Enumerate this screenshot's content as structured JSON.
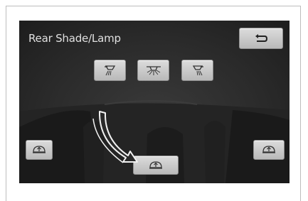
{
  "screen": {
    "title": "Rear Shade/Lamp"
  },
  "buttons": {
    "back": {
      "icon": "return-icon"
    },
    "lamp_left": {
      "icon": "lamp-left-icon"
    },
    "lamp_center": {
      "icon": "lamp-center-icon"
    },
    "lamp_right": {
      "icon": "lamp-right-icon"
    },
    "shade_left": {
      "icon": "shade-icon"
    },
    "shade_center": {
      "icon": "shade-icon"
    },
    "shade_right": {
      "icon": "shade-icon"
    }
  },
  "colors": {
    "screen_bg": "#2b2b2b",
    "button_bg": "#cfcfcf",
    "title_text": "#e0e0e0"
  }
}
